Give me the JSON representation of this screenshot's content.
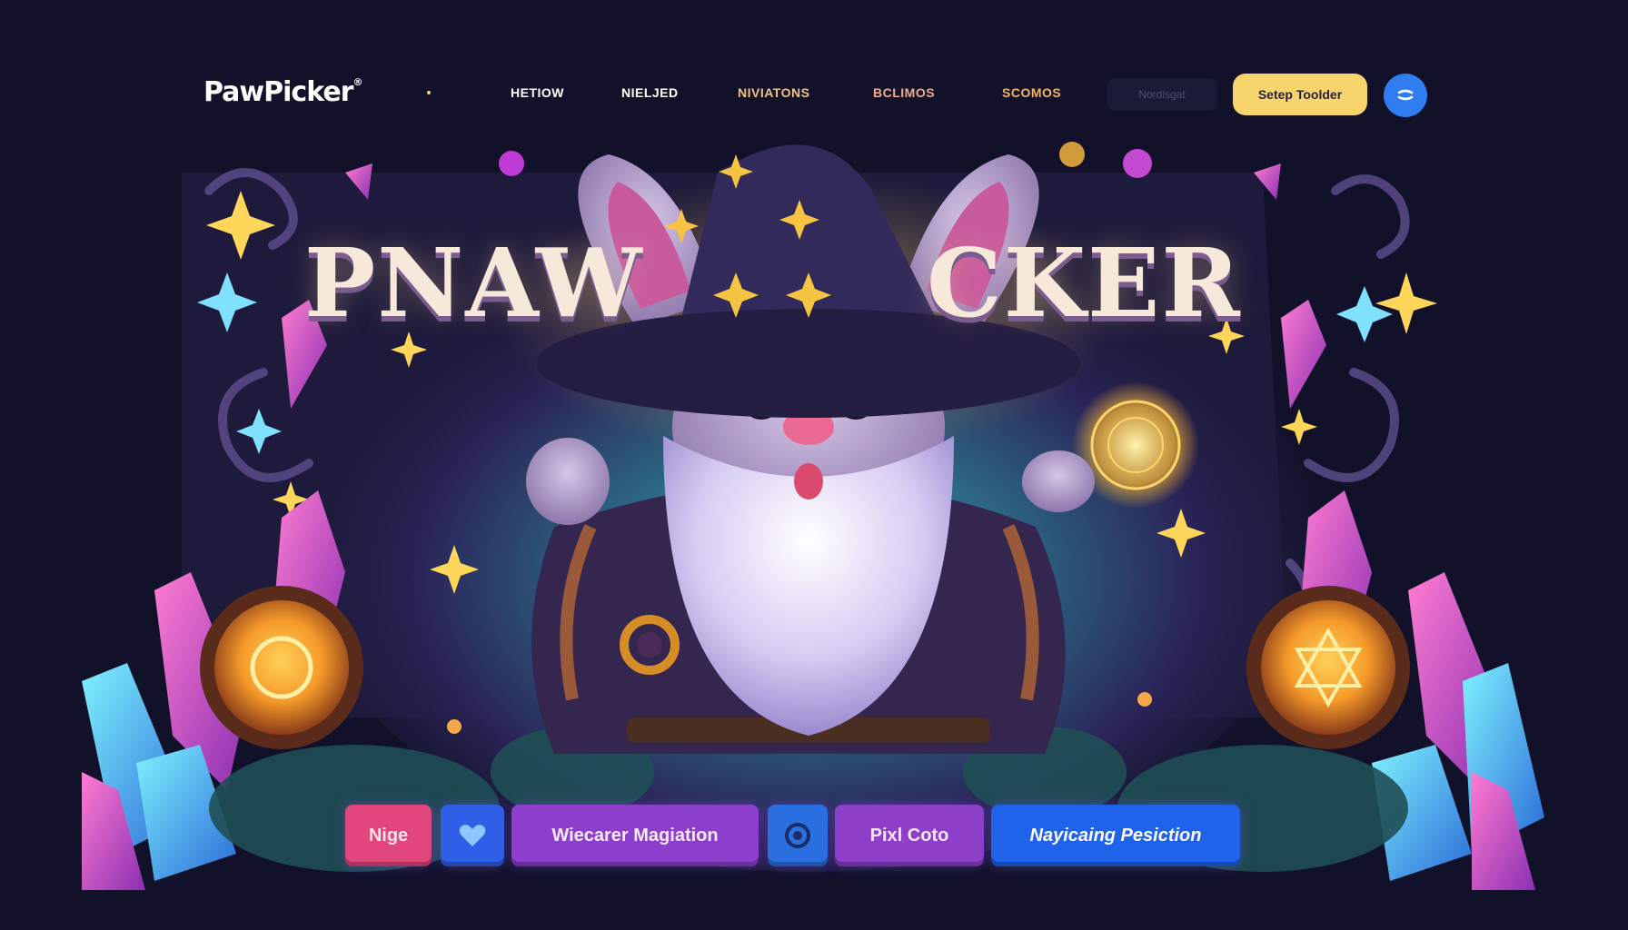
{
  "brand": {
    "name": "PawPicker",
    "mark": "®"
  },
  "nav": {
    "links": [
      "HETIOW",
      "NIELJED",
      "NIVIATONS",
      "BCLIMOS",
      "SCOMOS"
    ],
    "search_placeholder": "Nordisgat",
    "cta_label": "Setep Toolder",
    "round_icon": "menu-icon"
  },
  "hero": {
    "title_left": "PNAW",
    "title_right": "CKER"
  },
  "tabs": [
    {
      "label": "Nige"
    },
    {
      "label": "",
      "icon": "heart-icon"
    },
    {
      "label": "Wiecarer Magiation"
    },
    {
      "label": "",
      "icon": "target-icon"
    },
    {
      "label": "Pixl Coto"
    },
    {
      "label": "Nayicaing Pesiction"
    }
  ],
  "colors": {
    "background": "#11122a",
    "cta": "#f8d56c",
    "accent_blue": "#2f7df0",
    "accent_purple": "#8b3fcb",
    "accent_pink": "#e1467d"
  }
}
